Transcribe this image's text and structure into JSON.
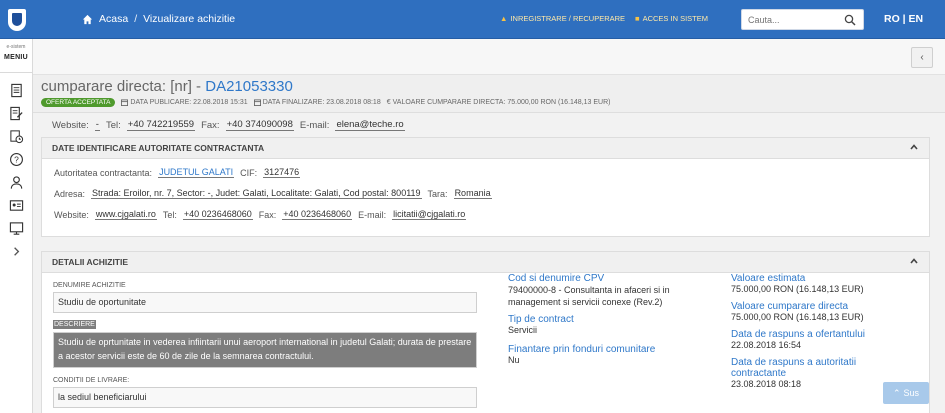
{
  "header": {
    "breadcrumb_home": "Acasa",
    "breadcrumb_sep": "/",
    "breadcrumb_current": "Vizualizare achizitie",
    "auth_register": "INREGISTRARE / RECUPERARE",
    "auth_login": "ACCES IN SISTEM",
    "search_placeholder": "Cauta...",
    "lang": "RO | EN"
  },
  "sidebar": {
    "small_text": "e-sistem",
    "menu_label": "MENIU",
    "icons": [
      "document-icon",
      "edit-document-icon",
      "clock-icon",
      "help-icon",
      "user-icon",
      "id-card-icon",
      "monitor-icon",
      "chevron-right-icon"
    ]
  },
  "title": {
    "prefix": "cumparare directa: [nr] - ",
    "code": "DA21053330",
    "badge": "OFERTA ACCEPTATA",
    "pub": "DATA PUBLICARE: 22.08.2018 15:31",
    "fin": "DATA FINALIZARE: 23.08.2018 08:18",
    "valoare": "VALOARE CUMPARARE DIRECTA: 75.000,00 RON (16.148,13 EUR)"
  },
  "contact_top": {
    "website_label": "Website:",
    "website_val": "-",
    "tel_label": "Tel:",
    "tel_val": "+40 742219559",
    "fax_label": "Fax:",
    "fax_val": "+40 374090098",
    "email_label": "E-mail:",
    "email_val": "elena@teche.ro"
  },
  "autoritate": {
    "title": "DATE IDENTIFICARE AUTORITATE CONTRACTANTA",
    "ac_label": "Autoritatea contractanta:",
    "ac_val": "JUDETUL GALATI",
    "cif_label": "CIF:",
    "cif_val": "3127476",
    "adresa_label": "Adresa:",
    "adresa_val": "Strada: Eroilor, nr. 7, Sector: -, Judet: Galati, Localitate: Galati, Cod postal: 800119",
    "tara_label": "Tara:",
    "tara_val": "Romania",
    "website_label": "Website:",
    "website_val": "www.cjgalati.ro",
    "tel_label": "Tel:",
    "tel_val": "+40 0236468060",
    "fax_label": "Fax:",
    "fax_val": "+40 0236468060",
    "email_label": "E-mail:",
    "email_val": "licitatii@cjgalati.ro"
  },
  "detalii": {
    "title": "DETALII ACHIZITIE",
    "den_label": "DENUMIRE ACHIZITIE",
    "den_val": "Studiu de oportunitate",
    "desc_label": "DESCRIERE",
    "desc_val": "Studiu de oprtunitate in vederea infiintarii unui aeroport international in judetul Galati; durata de prestare a acestor servicii este de 60 de zile de la semnarea contractului.",
    "cond_label": "CONDITII DE LIVRARE:",
    "cond_val": "la sediul beneficiarului",
    "cpv_label": "Cod si denumire CPV",
    "cpv_val": "79400000-8 - Consultanta in afaceri si in management si servicii conexe (Rev.2)",
    "tip_label": "Tip de contract",
    "tip_val": "Servicii",
    "fin_label": "Finantare prin fonduri comunitare",
    "fin_val": "Nu",
    "val_est_label": "Valoare estimata",
    "val_est_val": "75.000,00 RON (16.148,13 EUR)",
    "val_cump_label": "Valoare cumparare directa",
    "val_cump_val": "75.000,00 RON (16.148,13 EUR)",
    "raspuns_of_label": "Data de raspuns a ofertantului",
    "raspuns_of_val": "22.08.2018 16:54",
    "raspuns_ac_label": "Data de raspuns a autoritatii contractante",
    "raspuns_ac_val": "23.08.2018 08:18"
  },
  "scroll_top": "Sus",
  "colors": {
    "topbar": "#2f6fbf",
    "link": "#2f78c9",
    "badge": "#4f9a2d"
  }
}
